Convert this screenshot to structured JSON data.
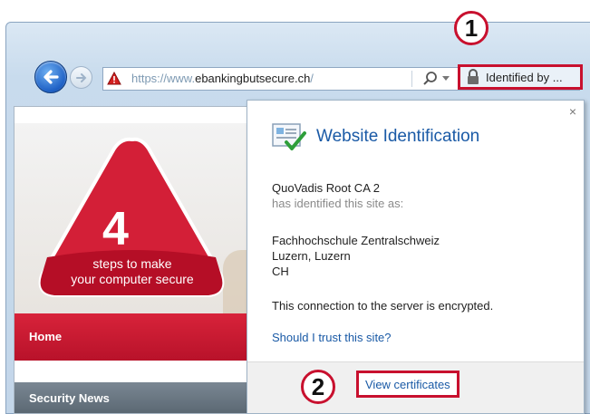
{
  "toolbar": {
    "url_scheme": "https://",
    "url_host_prefix": "www.",
    "url_host": "ebankingbutsecure.ch",
    "url_suffix": "/",
    "identified_label": "Identified by ..."
  },
  "callouts": [
    "1",
    "2"
  ],
  "page": {
    "hero_number": "4",
    "hero_line1": "steps to make",
    "hero_line2": "your computer secure",
    "nav_home": "Home",
    "nav_security_news": "Security News"
  },
  "popup": {
    "close": "×",
    "title": "Website Identification",
    "ca_name": "QuoVadis Root CA 2",
    "identified_text": "has identified this site as:",
    "org_line1": "Fachhochschule Zentralschweiz",
    "org_line2": "Luzern, Luzern",
    "org_line3": "CH",
    "encrypted_text": "This connection to the server is encrypted.",
    "trust_link": "Should I trust this site?",
    "view_certificates": "View certificates"
  },
  "colors": {
    "callout_border": "#c8102e",
    "link": "#1a5aa6",
    "brand_red": "#c8102e"
  }
}
